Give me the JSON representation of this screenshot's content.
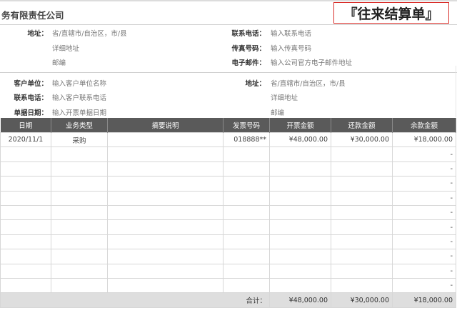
{
  "company": "务有限责任公司",
  "title": "『往来结算单』",
  "supplier": {
    "address_label": "地址：",
    "address_values": [
      "省/直辖市/自治区，市/县",
      "详细地址",
      "邮编"
    ],
    "phone_label": "联系电话：",
    "phone_value": "输入联系电话",
    "fax_label": "传真号码：",
    "fax_value": "输入传真号码",
    "email_label": "电子邮件：",
    "email_value": "输入公司官方电子邮件地址"
  },
  "customer": {
    "unit_label": "客户单位：",
    "unit_value": "输入客户单位名称",
    "phone_label": "联系电话：",
    "phone_value": "输入客户联系电话",
    "date_label": "单据日期：",
    "date_value": "输入开票单据日期",
    "address_label": "地址：",
    "address_values": [
      "省/直辖市/自治区，市/县",
      "详细地址",
      "邮编"
    ]
  },
  "table": {
    "headers": [
      "日期",
      "业务类型",
      "摘要说明",
      "发票号码",
      "开票金额",
      "还款金额",
      "余款金额"
    ],
    "first_row": [
      "2020/11/1",
      "采购",
      "",
      "018888**",
      "¥48,000.00",
      "¥30,000.00",
      "¥18,000.00"
    ],
    "empty_row_balance": "-",
    "empty_rows": 10,
    "total_label": "合计：",
    "total_invoice": "¥48,000.00",
    "total_repaid": "¥30,000.00",
    "total_balance": "¥18,000.00"
  }
}
